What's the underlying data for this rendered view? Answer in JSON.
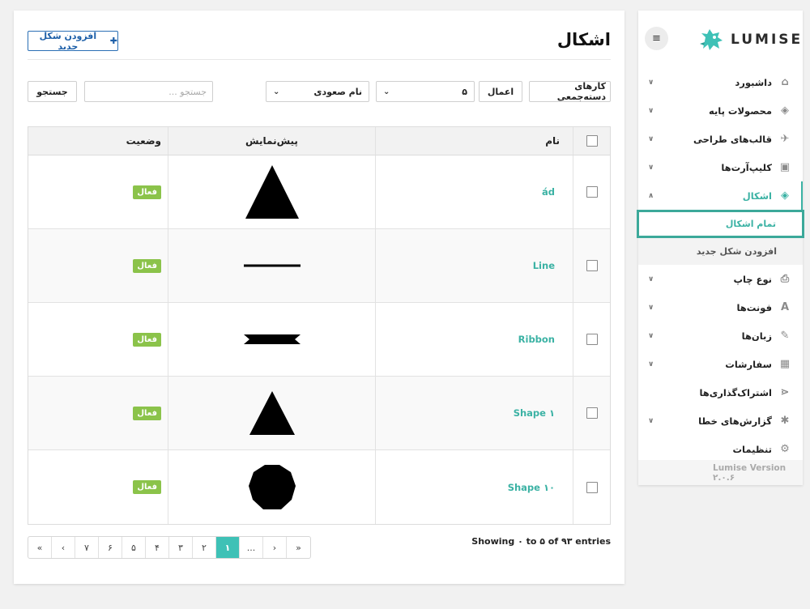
{
  "page": {
    "title": "اشکال",
    "add_button": "افزودن شکل جدید"
  },
  "toolbar": {
    "bulk_actions": "کارهای دسته‌جمعی",
    "apply": "اعمال",
    "per_page": "۵",
    "sort": "نام صعودی",
    "search_placeholder": "جستجو ...",
    "search_button": "جستجو"
  },
  "table": {
    "headers": {
      "name": "نام",
      "preview": "پیش‌نمایش",
      "status": "وضعیت"
    },
    "rows": [
      {
        "name": "ád",
        "shape": "triangle",
        "status": "فعال"
      },
      {
        "name": "Line",
        "shape": "line",
        "status": "فعال"
      },
      {
        "name": "Ribbon",
        "shape": "ribbon",
        "status": "فعال"
      },
      {
        "name": "Shape ۱",
        "shape": "triangle-small",
        "status": "فعال"
      },
      {
        "name": "Shape ۱۰",
        "shape": "polygon",
        "status": "فعال"
      }
    ]
  },
  "pagination": {
    "showing": "Showing ۰ to ۵ of ۹۳ entries",
    "pages": [
      "«",
      "‹",
      "۱",
      "۲",
      "۳",
      "۴",
      "۵",
      "۶",
      "۷",
      "...",
      "›",
      "»"
    ]
  },
  "sidebar": {
    "brand": "LUMISE",
    "menu": [
      {
        "label": "داشبورد",
        "icon": "home-icon",
        "glyph": "⌂",
        "chevron": true
      },
      {
        "label": "محصولات پایه",
        "icon": "cube-icon",
        "glyph": "◈",
        "chevron": true
      },
      {
        "label": "قالب‌های طراحی",
        "icon": "paper-plane-icon",
        "glyph": "✈",
        "chevron": true
      },
      {
        "label": "کلیپ‌آرت‌ها",
        "icon": "image-icon",
        "glyph": "▣",
        "chevron": true
      },
      {
        "label": "اشکال",
        "icon": "cube-icon",
        "glyph": "◈",
        "chevron": true,
        "active": true,
        "children": [
          {
            "label": "تمام اشکال",
            "current": true
          },
          {
            "label": "افزودن شکل جدید"
          }
        ]
      },
      {
        "label": "نوع چاپ",
        "icon": "printer-icon",
        "glyph": "⎙",
        "chevron": true
      },
      {
        "label": "فونت‌ها",
        "icon": "font-icon",
        "glyph": "A",
        "chevron": true
      },
      {
        "label": "زبان‌ها",
        "icon": "language-icon",
        "glyph": "✎",
        "chevron": true
      },
      {
        "label": "سفارشات",
        "icon": "shopping-bag-icon",
        "glyph": "▦",
        "chevron": true
      },
      {
        "label": "اشتراک‌گذاری‌ها",
        "icon": "share-icon",
        "glyph": "⋖",
        "chevron": false
      },
      {
        "label": "گزارش‌های خطا",
        "icon": "bug-icon",
        "glyph": "✱",
        "chevron": true
      },
      {
        "label": "تنظیمات",
        "icon": "gear-icon",
        "glyph": "⚙",
        "chevron": false
      }
    ],
    "version": "Lumise Version ۲.۰.۶"
  },
  "colors": {
    "accent": "#3bb2a4",
    "badge": "#8bc34a",
    "link": "#1d5fa8"
  }
}
